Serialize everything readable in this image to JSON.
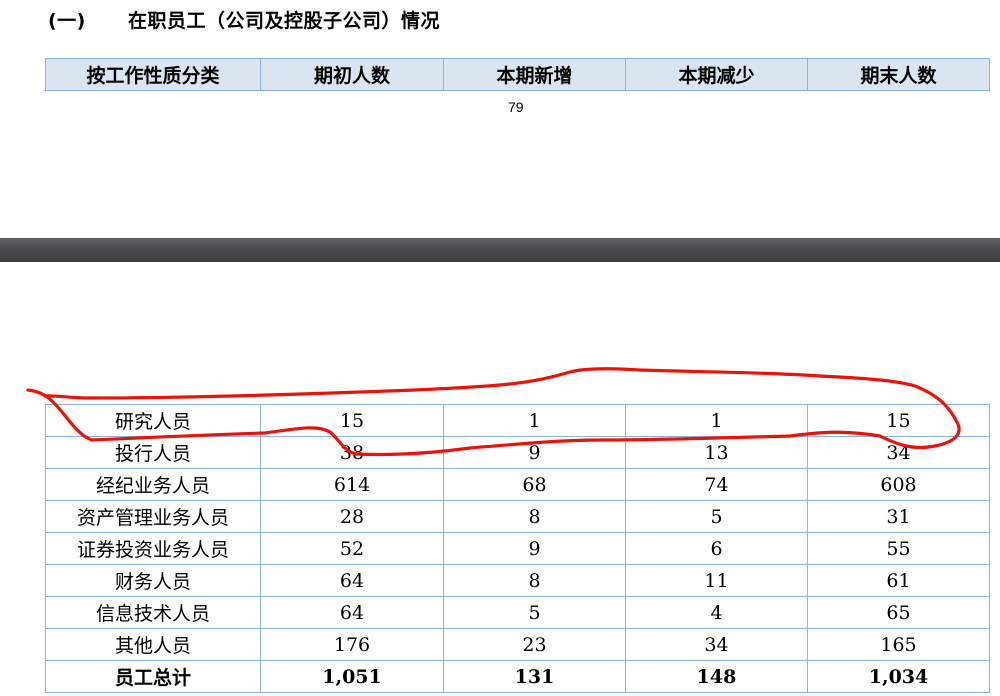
{
  "section": {
    "number": "(一)",
    "title": "在职员工（公司及控股子公司）情况"
  },
  "header_columns": [
    "按工作性质分类",
    "期初人数",
    "本期新增",
    "本期减少",
    "期末人数"
  ],
  "page_number": "79",
  "rows": [
    {
      "category": "研究人员",
      "start": "15",
      "added": "1",
      "reduced": "1",
      "end": "15"
    },
    {
      "category": "投行人员",
      "start": "38",
      "added": "9",
      "reduced": "13",
      "end": "34"
    },
    {
      "category": "经纪业务人员",
      "start": "614",
      "added": "68",
      "reduced": "74",
      "end": "608"
    },
    {
      "category": "资产管理业务人员",
      "start": "28",
      "added": "8",
      "reduced": "5",
      "end": "31"
    },
    {
      "category": "证券投资业务人员",
      "start": "52",
      "added": "9",
      "reduced": "6",
      "end": "55"
    },
    {
      "category": "财务人员",
      "start": "64",
      "added": "8",
      "reduced": "11",
      "end": "61"
    },
    {
      "category": "信息技术人员",
      "start": "64",
      "added": "5",
      "reduced": "4",
      "end": "65"
    },
    {
      "category": "其他人员",
      "start": "176",
      "added": "23",
      "reduced": "34",
      "end": "165"
    }
  ],
  "total_row": {
    "category": "员工总计",
    "start": "1,051",
    "added": "131",
    "reduced": "148",
    "end": "1,034"
  },
  "colors": {
    "header_fill": "#dbe5f1",
    "grid_line": "#8db3e2",
    "annotation": "#e8140c",
    "page_gap": "#4a4c4e"
  }
}
